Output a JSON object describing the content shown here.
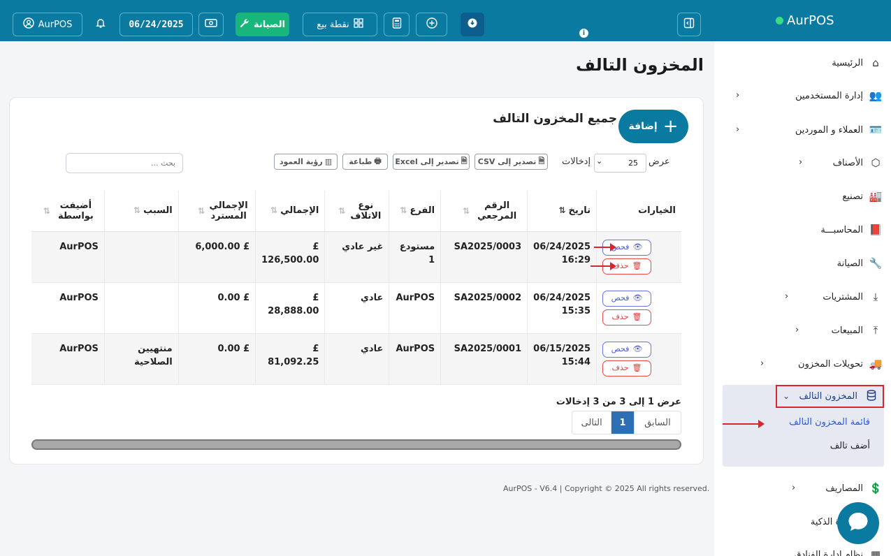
{
  "topbar": {
    "user": "AurPOS",
    "date": "06/24/2025",
    "maintenance": "الصيانة",
    "pos": "نقطة بيع"
  },
  "sidebar": {
    "brand": "AurPOS",
    "home": "الرئيسية",
    "users": "إدارة المستخدمين",
    "contacts": "العملاء و الموردين",
    "products": "الأصناف",
    "manufacturing": "تصنيع",
    "accounting": "المحاسبـــة",
    "maintenance": "الصيانة",
    "purchases": "المشتريات",
    "sales": "المبيعات",
    "transfers": "تحويلات المخزون",
    "damaged": "المخزون التالف",
    "damaged_list": "قائمة المخزون التالف",
    "add_damaged": "أضف تالف",
    "expenses": "المصاريف",
    "smart_base": "القاعدة الذكية",
    "restaurant": "نظام ادارة الفنادق"
  },
  "main": {
    "page_title": "المخزون التالف",
    "card_title": "جميع المخزون التالف",
    "add_label": "إضافة",
    "show_label": "عرض",
    "entries_label": "إدخالات",
    "page_size": "25",
    "export_csv": "تصدير إلى CSV",
    "export_excel": "تصدير إلى Excel",
    "print": "طباعة",
    "column_visibility": "رؤية العمود",
    "search_placeholder": "بحث ...",
    "view_label": "فحص",
    "delete_label": "حذف"
  },
  "table": {
    "headers": {
      "options": "الخيارات",
      "date": "تاريخ",
      "ref": "الرقم المرجعي",
      "branch": "الفرع",
      "type": "نوع الاتلاف",
      "total": "الإجمالي",
      "recovered": "الإجمالي المسترد",
      "reason": "السبب",
      "added_by": "أضيفت بواسطة"
    },
    "rows": [
      {
        "date": "06/24/2025 16:29",
        "ref": "SA2025/0003",
        "branch": "مستودع 1",
        "type": "غير عادي",
        "total": "£ 126,500.00",
        "recovered": "£ 6,000.00",
        "reason": "",
        "added_by": "AurPOS"
      },
      {
        "date": "06/24/2025 15:35",
        "ref": "SA2025/0002",
        "branch": "AurPOS",
        "type": "عادي",
        "total": "£ 28,888.00",
        "recovered": "£ 0.00",
        "reason": "",
        "added_by": "AurPOS"
      },
      {
        "date": "06/15/2025 15:44",
        "ref": "SA2025/0001",
        "branch": "AurPOS",
        "type": "عادي",
        "total": "£ 81,092.25",
        "recovered": "£ 0.00",
        "reason": "منتهيين الصلاحية",
        "added_by": "AurPOS"
      }
    ]
  },
  "pagination": {
    "info": "عرض 1 إلى 3 من 3 إدخالات",
    "prev": "السابق",
    "current": "1",
    "next": "التالى"
  },
  "footer": "AurPOS - V6.4 | Copyright © 2025 All rights reserved."
}
